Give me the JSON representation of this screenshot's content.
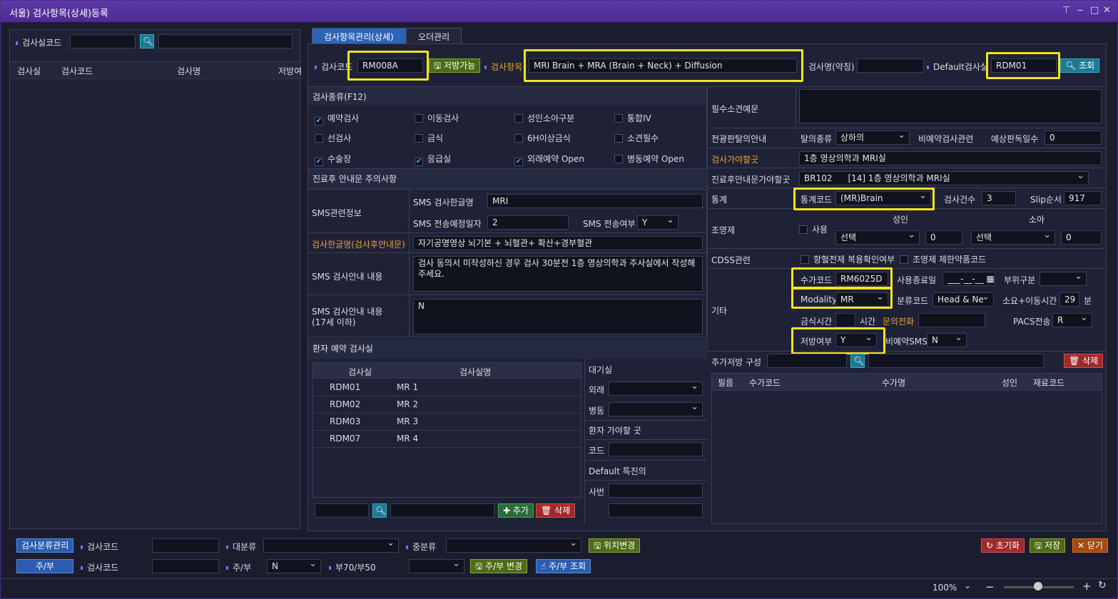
{
  "window": {
    "title": "서울) 검사항목(상세)등록",
    "controls": [
      "⌱",
      "‒",
      "□",
      "✕"
    ]
  },
  "left": {
    "lab_code_label": "검사실코드",
    "cols": [
      "검사실",
      "검사코드",
      "검사명",
      "저방여"
    ]
  },
  "tabs": [
    "검사항목관리(상세)",
    "오더관리"
  ],
  "header": {
    "code_label": "검사코드",
    "code": "RM008A",
    "rx_btn": "저방가능",
    "item_label": "검사항목",
    "item": "MRI Brain + MRA (Brain + Neck) + Diffusion",
    "short_label": "검사명(약칭)",
    "short": "",
    "default_label": "Default검사실",
    "default": "RDM01",
    "search_btn": "조회"
  },
  "kind": {
    "title": "검사종류(F12)",
    "items": [
      {
        "label": "예약검사",
        "checked": true
      },
      {
        "label": "이동검사",
        "checked": false
      },
      {
        "label": "성인소아구분",
        "checked": false
      },
      {
        "label": "통합IV",
        "checked": false
      },
      {
        "label": "선검사",
        "checked": false
      },
      {
        "label": "금식",
        "checked": false
      },
      {
        "label": "6H이상금식",
        "checked": false
      },
      {
        "label": "소견필수",
        "checked": false
      },
      {
        "label": "수술장",
        "checked": true
      },
      {
        "label": "응급실",
        "checked": true
      },
      {
        "label": "외래예약 Open",
        "checked": true
      },
      {
        "label": "병동예약 Open",
        "checked": false
      }
    ]
  },
  "notice": {
    "title": "진료후 안내문 주의사항",
    "sms_info": "SMS관련정보",
    "sms_kor_label": "SMS 검사한글명",
    "sms_kor": "MRI",
    "sms_date_label": "SMS 전송예정일자",
    "sms_date": "2",
    "sms_send_label": "SMS 전송여부",
    "sms_send": "Y",
    "kor_name_label": "검사한글명(검사후안내문)",
    "kor_name": "자기공명영상 뇌기본 + 뇌혈관+ 확산+경부혈관",
    "guide_label": "SMS 검사안내 내용",
    "guide": "검사 동의서 미작성하신 경우 검사 30분전 1층 영상의학과 주사실에서 작성해 주세요.",
    "guide17_label": "SMS 검사안내 내용\n(17세 이하)",
    "guide17": "N"
  },
  "rooms": {
    "title": "환자 예약 검사실",
    "cols": [
      "검사실",
      "검사실명"
    ],
    "rows": [
      [
        "RDM01",
        "MR 1"
      ],
      [
        "RDM02",
        "MR 2"
      ],
      [
        "RDM03",
        "MR 3"
      ],
      [
        "RDM07",
        "MR 4"
      ]
    ],
    "add": "추가",
    "del": "삭제",
    "wait": "대기실",
    "out": "외래",
    "ward": "병동",
    "goto": "환자 가야할 곳",
    "code": "코드",
    "default_doc": "Default 특진의",
    "license": "사번"
  },
  "right": {
    "required_label": "필수소견예문",
    "transfer_label": "전광판탈의안내",
    "undress_label": "탈의종류",
    "undress": "상하의",
    "nonres_label": "비예약검사관련",
    "readdays_label": "예상판독일수",
    "readdays": "0",
    "place_label": "검사가야할곳",
    "place": "1층 영상의학과 MRI실",
    "after_label": "진료후안내문가야할곳",
    "after_code": "BR102",
    "after": "[14] 1층 영상의학과 MRI실",
    "stat_label": "통계",
    "statcode_label": "통계코드",
    "statcode": "(MR)Brain",
    "count_label": "검사건수",
    "count": "3",
    "slip_label": "Slip순서",
    "slip": "917",
    "contrast_label": "조영제",
    "adult": "성인",
    "child": "소아",
    "use": "사용",
    "select1": "선택",
    "v1": "0",
    "select2": "선택",
    "v2": "0",
    "cdss_label": "CDSS관련",
    "cdss1": "항혈전제 복용확인여부",
    "cdss2": "조영제 제한약품코드",
    "etc_label": "기타",
    "fee_label": "수가코드",
    "fee": "RM6025D",
    "enddate_label": "사용종료일",
    "enddate": "___-__-__",
    "part_label": "부위구분",
    "modality_label": "Modality",
    "modality": "MR",
    "class_label": "분류코드",
    "class": "Head & Ne",
    "time_label": "소요+이동시간",
    "time": "29",
    "min": "분",
    "fast_label": "금식시간",
    "hour": "시간",
    "inquiry": "문의전화",
    "pacs_label": "PACS전송",
    "pacs": "R",
    "rx_label": "저방여부",
    "rx": "Y",
    "nonres_sms_label": "비예약SMS",
    "nonres_sms": "N",
    "addrx_label": "추가저방 구성",
    "del": "삭제",
    "cols": [
      "필름",
      "수가코드",
      "수가명",
      "성인",
      "재료코드"
    ]
  },
  "bottom": {
    "b1": "검사분류관리",
    "code1": "검사코드",
    "big": "대분류",
    "mid": "중분류",
    "move": "위치변경",
    "b2": "주/부",
    "code2": "검사코드",
    "mainsub": "주/부",
    "mainsub_val": "N",
    "ratio": "부70/부50",
    "change": "주/부 변경",
    "query": "주/부 조회",
    "reset": "초기화",
    "save": "저장",
    "close": "닫기"
  },
  "status": {
    "zoom": "100%"
  }
}
